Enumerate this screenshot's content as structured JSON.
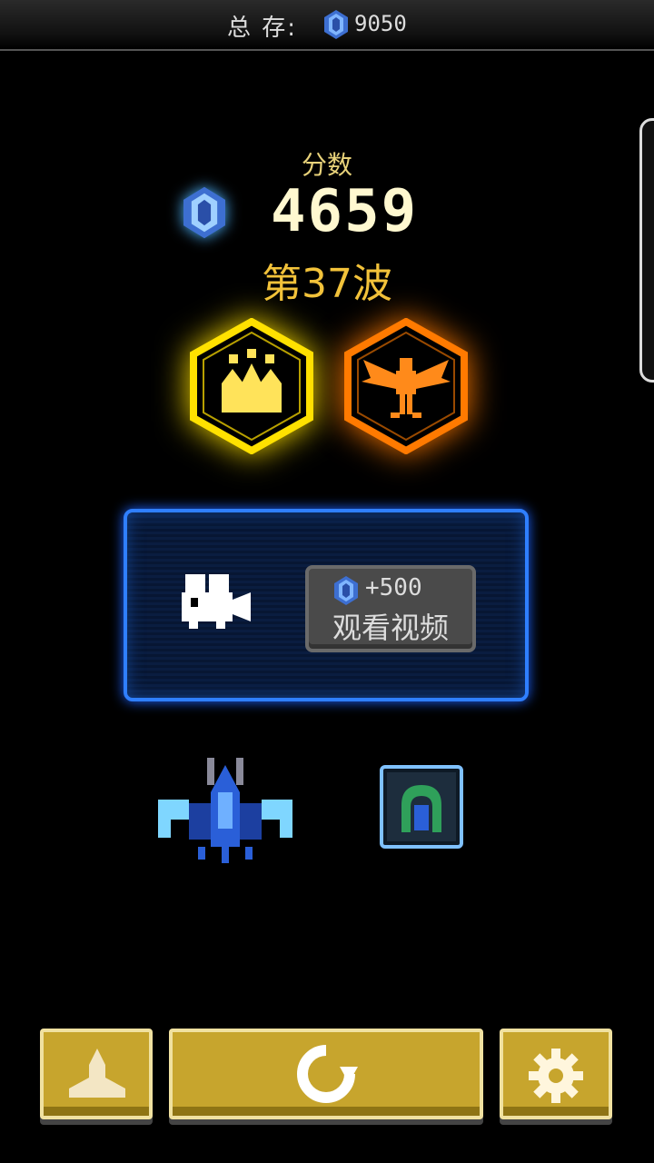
{
  "header": {
    "total_label": "总 存:",
    "total_value": "9050",
    "gem_icon": "blue-gem-icon"
  },
  "score": {
    "label": "分数",
    "value": "4659",
    "wave": "第37波"
  },
  "medals": [
    {
      "name": "crown-medal",
      "color": "#ffe000"
    },
    {
      "name": "phoenix-medal",
      "color": "#ff7a00"
    }
  ],
  "video_offer": {
    "reward": "+500",
    "button_label": "观看视频",
    "icon": "video-camera-icon"
  },
  "loadout": {
    "ship": "blue-fighter-ship",
    "item": "green-shield-item"
  },
  "bottom_bar": {
    "left": "ship-select-icon",
    "center": "restart-icon",
    "right": "gear-icon"
  },
  "colors": {
    "accent_blue": "#2f7fff",
    "gold": "#c7a52d",
    "score_yellow": "#f2c23a"
  }
}
